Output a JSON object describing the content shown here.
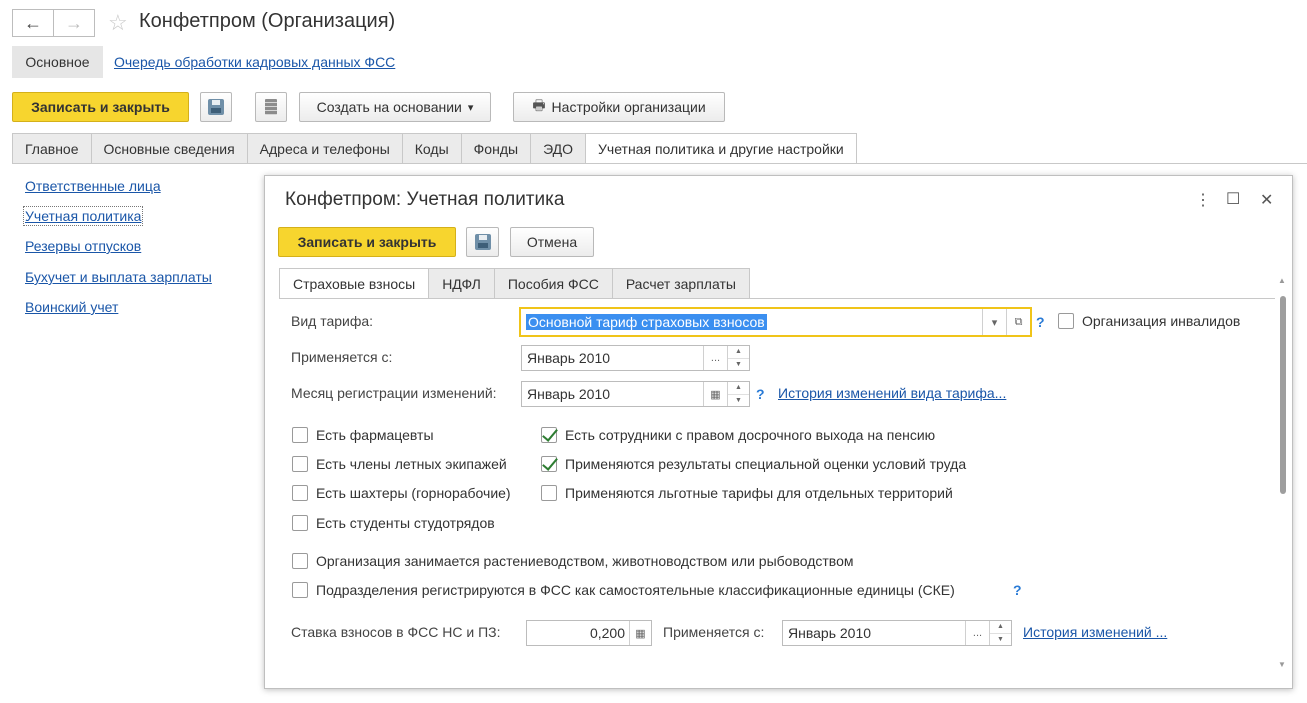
{
  "window": {
    "title": "Конфетпром (Организация)",
    "back_icon": "←",
    "forward_icon": "→",
    "favorite_icon": "☆"
  },
  "mode_tabs": {
    "main": "Основное",
    "queue_link": "Очередь обработки кадровых данных ФСС"
  },
  "toolbar": {
    "save_close": "Записать и закрыть",
    "create_based": "Создать на основании",
    "create_based_arrow": "▾",
    "org_settings": "Настройки организации",
    "org_settings_icon": "🖶"
  },
  "tabs": [
    {
      "label": "Главное"
    },
    {
      "label": "Основные сведения"
    },
    {
      "label": "Адреса и телефоны"
    },
    {
      "label": "Коды"
    },
    {
      "label": "Фонды"
    },
    {
      "label": "ЭДО"
    },
    {
      "label": "Учетная политика и другие настройки"
    }
  ],
  "sidebar": {
    "items": [
      {
        "label": "Ответственные лица"
      },
      {
        "label": "Учетная политика"
      },
      {
        "label": "Резервы отпусков"
      },
      {
        "label": "Бухучет и выплата зарплаты"
      },
      {
        "label": "Воинский учет"
      }
    ]
  },
  "dialog": {
    "title": "Конфетпром: Учетная политика",
    "more_icon": "⋮",
    "maximize_icon": "☐",
    "close_icon": "✕",
    "save_close": "Записать и закрыть",
    "cancel": "Отмена",
    "tabs": [
      {
        "label": "Страховые взносы"
      },
      {
        "label": "НДФЛ"
      },
      {
        "label": "Пособия ФСС"
      },
      {
        "label": "Расчет зарплаты"
      }
    ],
    "tariff_label": "Вид тарифа:",
    "tariff_value": "Основной тариф страховых взносов",
    "help_mark": "?",
    "disabled_org": "Организация инвалидов",
    "applies_from_label": "Применяется с:",
    "applies_from_value": "Январь 2010",
    "reg_month_label": "Месяц регистрации изменений:",
    "reg_month_value": "Январь 2010",
    "tariff_history_link": "История изменений вида тарифа...",
    "checkboxes_left": [
      {
        "label": "Есть фармацевты",
        "checked": false
      },
      {
        "label": "Есть члены летных экипажей",
        "checked": false
      },
      {
        "label": "Есть шахтеры (горнорабочие)",
        "checked": false
      },
      {
        "label": "Есть студенты студотрядов",
        "checked": false
      }
    ],
    "checkboxes_right": [
      {
        "label": "Есть сотрудники с правом досрочного выхода на пенсию",
        "checked": true
      },
      {
        "label": "Применяются результаты специальной оценки условий труда",
        "checked": true
      },
      {
        "label": "Применяются льготные тарифы для отдельных территорий",
        "checked": false
      }
    ],
    "agri_label": "Организация занимается растениеводством, животноводством или рыбоводством",
    "ske_label": "Подразделения регистрируются в ФСС как самостоятельные классификационные единицы (СКЕ)",
    "fss_rate_label": "Ставка взносов в ФСС НС и ПЗ:",
    "fss_rate_value": "0,200",
    "fss_applies_label": "Применяется с:",
    "fss_applies_value": "Январь 2010",
    "fss_history_link": "История изменений ..."
  }
}
